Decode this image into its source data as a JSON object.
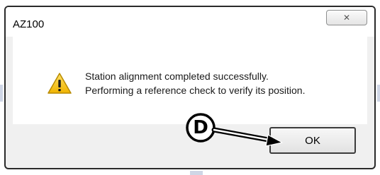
{
  "dialog": {
    "title": "AZ100",
    "close_icon": "close-x-icon",
    "icon": "warning-icon",
    "message_lines": [
      "Station alignment completed successfully.",
      "Performing a reference check to verify its position."
    ],
    "ok_label": "OK"
  },
  "callout": {
    "label": "D"
  },
  "colors": {
    "warning_fill": "#f5c000",
    "dialog_body": "#ffffff",
    "dialog_footer": "#f0f0f0"
  }
}
